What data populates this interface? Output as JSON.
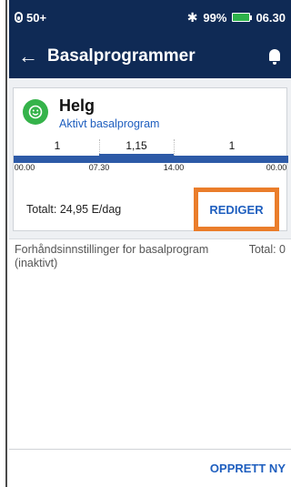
{
  "statusbar": {
    "pod_level": "50+",
    "battery_percent": "99%",
    "time": "06.30",
    "icons": [
      "pod-icon",
      "bluetooth-icon",
      "battery-icon"
    ],
    "battery_color": "#2db24a"
  },
  "appbar": {
    "title": "Basalprogrammer",
    "back_icon": "arrow-left-icon",
    "notification_icon": "bell-icon",
    "background": "#0f2a55"
  },
  "program": {
    "name": "Helg",
    "status": "Aktivt basalprogram",
    "icon": "smile-icon",
    "segments": [
      {
        "rate": "1",
        "start": "00.00",
        "end": "07.30"
      },
      {
        "rate": "1,15",
        "start": "07.30",
        "end": "14.00"
      },
      {
        "rate": "1",
        "start": "14.00",
        "end": "00.00"
      }
    ],
    "time_labels": [
      "00.00",
      "07.30",
      "14.00",
      "00.00"
    ],
    "total": "Totalt: 24,95 E/dag",
    "edit_label": "REDIGER",
    "highlight_color": "#ea7d2b"
  },
  "presets": {
    "label": "Forhåndsinnstillinger for basalprogram (inaktivt)",
    "total": "Total: 0"
  },
  "footer": {
    "create_label": "OPPRETT NY"
  }
}
